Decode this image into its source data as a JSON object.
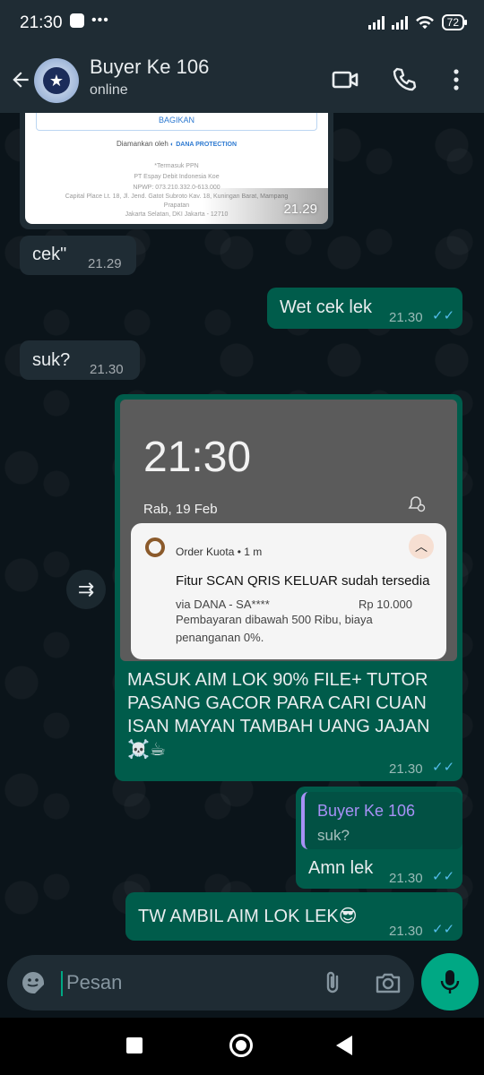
{
  "status_bar": {
    "time": "21:30",
    "dots": "•••",
    "battery": "72"
  },
  "header": {
    "contact_name": "Buyer Ke 106",
    "contact_status": "online"
  },
  "receipt": {
    "share_label": "BAGIKAN",
    "secured_by": "Diamankan oleh",
    "secured_brand": "DANA PROTECTION",
    "lines": [
      "*Termasuk PPN",
      "PT Espay Debit Indonesia Koe",
      "NPWP: 073.210.332.0-613.000",
      "Capital Place Lt. 18, Jl. Jend. Gatot Subroto Kav. 18, Kuningan Barat, Mampang",
      "Prapatan",
      "Jakarta Selatan, DKI Jakarta - 12710"
    ],
    "time": "21.29"
  },
  "messages": [
    {
      "text": "cek\"",
      "time": "21.29"
    },
    {
      "text": "Wet cek lek",
      "time": "21.30",
      "ticks": "✓✓"
    },
    {
      "text": "suk?",
      "time": "21.30"
    },
    {
      "caption": "MASUK AIM LOK 90% FILE+ TUTOR PASANG GACOR PARA CARI CUAN ISAN MAYAN TAMBAH UANG JAJAN ☠️☕",
      "time": "21.30",
      "ticks": "✓✓",
      "screenshot": {
        "lock_time": "21:30",
        "lock_date": "Rab, 19 Feb",
        "notif_app": "Order Kuota • 1 m",
        "notif_title": "Fitur SCAN QRIS KELUAR sudah tersedia",
        "notif_sub": "via DANA - SA****",
        "notif_amount": "Rp 10.000",
        "notif_desc": "Pembayaran dibawah 500 Ribu, biaya penanganan 0%."
      }
    },
    {
      "quote_name": "Buyer Ke 106",
      "quote_text": "suk?",
      "text": "Amn lek",
      "time": "21.30",
      "ticks": "✓✓"
    },
    {
      "text": "TW AMBIL AIM LOK LEK😎",
      "time": "21.30",
      "ticks": "✓✓"
    }
  ],
  "input": {
    "placeholder": "Pesan"
  },
  "colors": {
    "incoming": "#1f2c34",
    "outgoing": "#005c4b",
    "accent": "#00a884",
    "read_ticks": "#53bdeb"
  }
}
